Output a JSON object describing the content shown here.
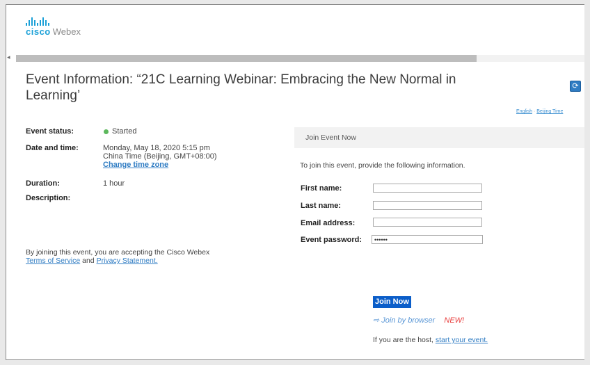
{
  "brand": {
    "cisco": "cisco",
    "webex": "Webex",
    "accent": "#1ba0d7"
  },
  "page": {
    "title": "Event Information: “21C Learning Webinar: Embracing the New Normal in Learning’"
  },
  "toplinks": {
    "language": "English",
    "separator": "·",
    "time": "Beijing Time"
  },
  "event": {
    "status_label": "Event status:",
    "status_value": "Started",
    "date_label": "Date and time:",
    "date_line1": "Monday, May 18, 2020 5:15 pm",
    "date_line2": "China Time (Beijing, GMT+08:00)",
    "change_tz": "Change time zone",
    "duration_label": "Duration:",
    "duration_value": "1 hour",
    "description_label": "Description:"
  },
  "accept": {
    "text": "By joining this event, you are accepting the Cisco Webex",
    "tos": "Terms of Service",
    "and": "and",
    "privacy": "Privacy Statement."
  },
  "join": {
    "header": "Join Event Now",
    "instructions": "To join this event, provide the following information.",
    "first_name_label": "First name:",
    "last_name_label": "Last name:",
    "email_label": "Email address:",
    "password_label": "Event password:",
    "password_value": "••••••",
    "join_button": "Join Now",
    "browser_link": "Join by browser",
    "browser_new": "NEW!",
    "host_text": "If you are the host,",
    "host_link": "start your event."
  },
  "colors": {
    "join_button": "#0b5ec9",
    "status_dot": "#5cb85c",
    "new_badge": "#e8403f",
    "link": "#2f7cc3"
  }
}
